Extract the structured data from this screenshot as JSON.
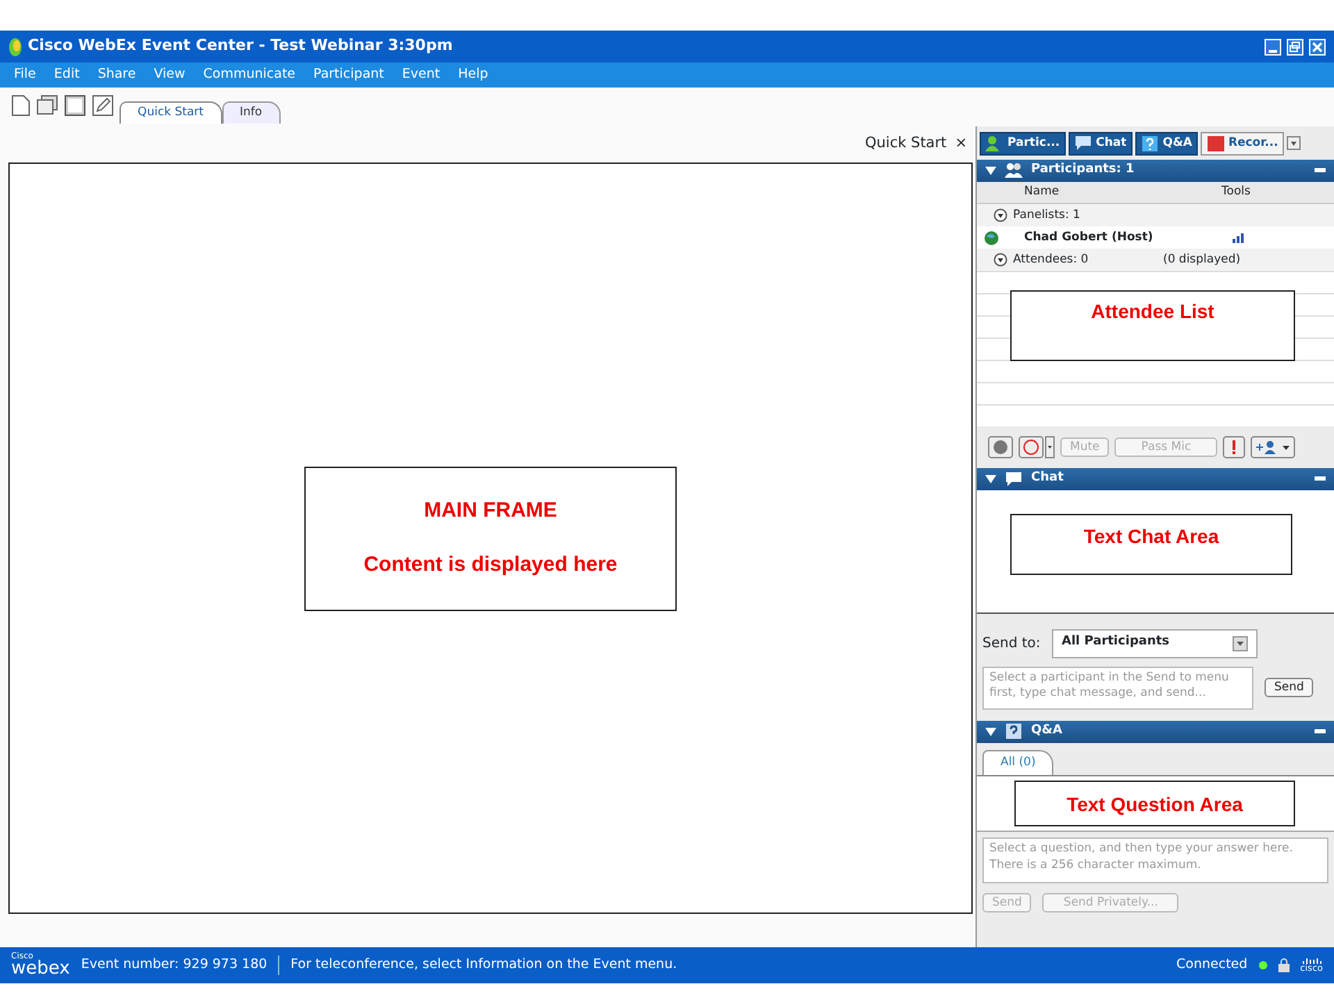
{
  "window": {
    "title": "Cisco WebEx Event Center - Test Webinar 3:30pm"
  },
  "menu": [
    "File",
    "Edit",
    "Share",
    "View",
    "Communicate",
    "Participant",
    "Event",
    "Help"
  ],
  "doc_tabs": [
    {
      "label": "Quick Start",
      "selected": true
    },
    {
      "label": "Info",
      "selected": false
    }
  ],
  "frame_bar": {
    "label": "Quick Start",
    "close": "×"
  },
  "panel_tabs": [
    {
      "label": "Partic...",
      "kind": "participants"
    },
    {
      "label": "Chat",
      "kind": "chat"
    },
    {
      "label": "Q&A",
      "kind": "qa"
    },
    {
      "label": "Recor...",
      "kind": "recorder"
    }
  ],
  "main_frame": {
    "annotation_title": "MAIN FRAME",
    "annotation_text": "Content is displayed here"
  },
  "participants": {
    "header": "Participants: 1",
    "columns": [
      "Name",
      "Tools"
    ],
    "groups": [
      {
        "label": "Panelists: 1",
        "expanded": true,
        "members": [
          {
            "name": "Chad Gobert (Host)"
          }
        ]
      },
      {
        "label": "Attendees: 0",
        "note": "(0 displayed)",
        "expanded": true
      }
    ],
    "annotation": "Attendee List",
    "buttons": [
      {
        "label": "Mute",
        "disabled": true
      },
      {
        "label": "Pass Mic",
        "disabled": true
      }
    ]
  },
  "chat": {
    "header": "Chat",
    "annotation": "Text Chat Area",
    "send_to_label": "Send to:",
    "send_to_value": "All Participants",
    "placeholder": "Select a participant in the Send to menu first, type chat message, and send...",
    "send_button": {
      "label": "Send",
      "disabled": false
    }
  },
  "qa": {
    "header": "Q&A",
    "tabs": [
      {
        "label": "All (0)",
        "selected": true
      }
    ],
    "annotation": "Text Question Area",
    "placeholder": "Select a question, and then type your answer here. There is a 256 character maximum.",
    "buttons": [
      {
        "label": "Send",
        "disabled": true
      },
      {
        "label": "Send Privately...",
        "disabled": true
      }
    ]
  },
  "status_bar": {
    "logo_small": "Cisco",
    "logo": "webex",
    "event_number": "Event number: 929 973 180",
    "note": "For teleconference, select Information on the Event menu.",
    "connection": "Connected",
    "cisco": "cisco"
  }
}
